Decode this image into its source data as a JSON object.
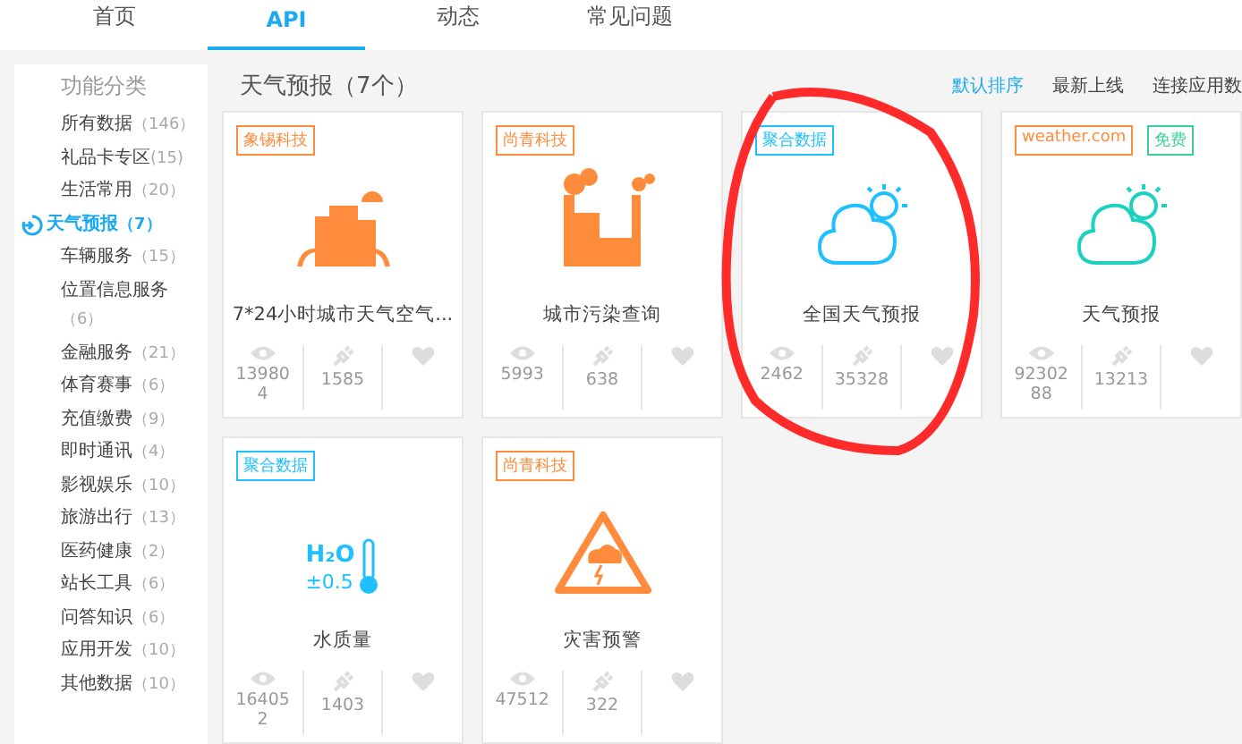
{
  "nav": {
    "tabs": [
      {
        "label": "首页",
        "selected": false
      },
      {
        "label": "API",
        "selected": true
      },
      {
        "label": "动态",
        "selected": false
      },
      {
        "label": "常见问题",
        "selected": false
      }
    ]
  },
  "sidebar": {
    "title": "功能分类",
    "items": [
      {
        "name": "所有数据",
        "count": "（146）",
        "selected": false
      },
      {
        "name": "礼品卡专区",
        "count": "(15)",
        "selected": false
      },
      {
        "name": "生活常用",
        "count": "（20）",
        "selected": false
      },
      {
        "name": "天气预报",
        "count": "（7）",
        "selected": true
      },
      {
        "name": "车辆服务",
        "count": "（15）",
        "selected": false
      },
      {
        "name": "位置信息服务",
        "count": "（6）",
        "selected": false
      },
      {
        "name": "金融服务",
        "count": "（21）",
        "selected": false
      },
      {
        "name": "体育赛事",
        "count": "（6）",
        "selected": false
      },
      {
        "name": "充值缴费",
        "count": "（9）",
        "selected": false
      },
      {
        "name": "即时通讯",
        "count": "（4）",
        "selected": false
      },
      {
        "name": "影视娱乐",
        "count": "（10）",
        "selected": false
      },
      {
        "name": "旅游出行",
        "count": "（13）",
        "selected": false
      },
      {
        "name": "医药健康",
        "count": "（2）",
        "selected": false
      },
      {
        "name": "站长工具",
        "count": "（6）",
        "selected": false
      },
      {
        "name": "问答知识",
        "count": "（6）",
        "selected": false
      },
      {
        "name": "应用开发",
        "count": "（10）",
        "selected": false
      },
      {
        "name": "其他数据",
        "count": "（10）",
        "selected": false
      }
    ]
  },
  "main": {
    "title": "天气预报（7个）",
    "sort": [
      {
        "label": "默认排序",
        "selected": true
      },
      {
        "label": "最新上线",
        "selected": false
      },
      {
        "label": "连接应用数",
        "selected": false
      }
    ],
    "cards": [
      {
        "tags": [
          {
            "text": "象锡科技",
            "color": "#ff8c3c"
          }
        ],
        "kind": "building",
        "color": "#ff8c3c",
        "title": "7*24小时城市天气空气...",
        "views": "139804",
        "connections": "1585",
        "circled": false
      },
      {
        "tags": [
          {
            "text": "尚青科技",
            "color": "#ff8c3c"
          }
        ],
        "kind": "factory",
        "color": "#ff8c3c",
        "title": "城市污染查询",
        "views": "5993",
        "connections": "638",
        "circled": false
      },
      {
        "tags": [
          {
            "text": "聚合数据",
            "color": "#1ec0ff"
          }
        ],
        "kind": "cloud",
        "color": "#1ec0ff",
        "title": "全国天气预报",
        "views": "2462",
        "connections": "35328",
        "circled": true
      },
      {
        "tags": [
          {
            "text": "weather.com",
            "color": "#ff8c3c"
          },
          {
            "text": "免费",
            "color": "#3ccf9a"
          }
        ],
        "kind": "cloud",
        "color": "#1ed0c0",
        "title": "天气预报",
        "views": "9230288",
        "connections": "13213",
        "circled": false
      },
      {
        "tags": [
          {
            "text": "聚合数据",
            "color": "#1ec0ff"
          }
        ],
        "kind": "water",
        "icon_text": [
          "H₂O",
          "±0.5"
        ],
        "color": "#1ec0ff",
        "title": "水质量",
        "views": "164052",
        "connections": "1403",
        "circled": false
      },
      {
        "tags": [
          {
            "text": "尚青科技",
            "color": "#ff8c3c"
          }
        ],
        "kind": "warning",
        "color": "#ff8c3c",
        "title": "灾害预警",
        "views": "47512",
        "connections": "322",
        "circled": false
      }
    ]
  }
}
